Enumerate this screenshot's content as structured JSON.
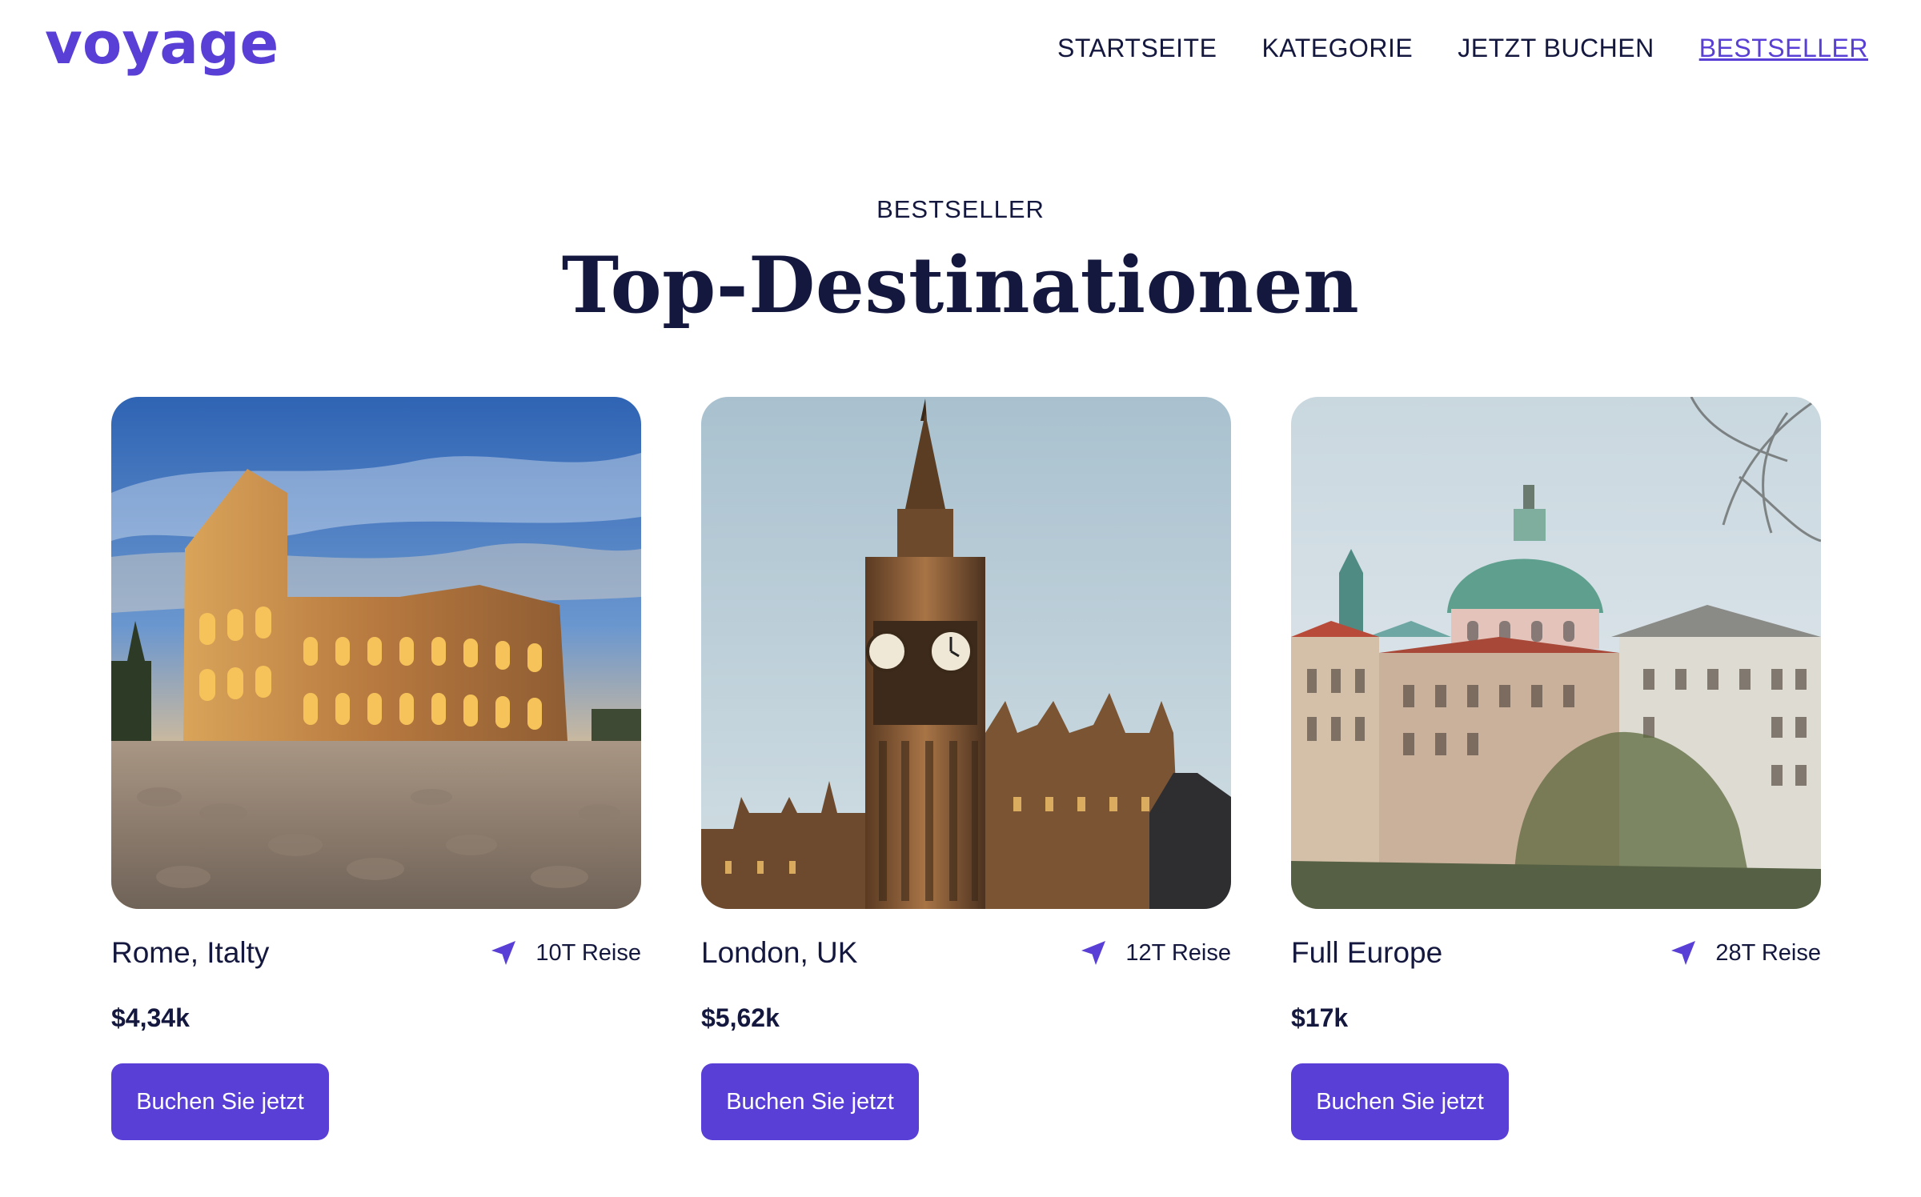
{
  "header": {
    "logo": "voyage",
    "nav": [
      {
        "label": "STARTSEITE"
      },
      {
        "label": "KATEGORIE"
      },
      {
        "label": "JETZT BUCHEN"
      },
      {
        "label": "BESTSELLER"
      }
    ]
  },
  "section": {
    "eyebrow": "BESTSELLER",
    "title": "Top-Destinationen"
  },
  "cards": [
    {
      "place": "Rome, Italty",
      "trip": "10T Reise",
      "price": "$4,34k",
      "button": "Buchen Sie jetzt"
    },
    {
      "place": "London, UK",
      "trip": "12T Reise",
      "price": "$5,62k",
      "button": "Buchen Sie jetzt"
    },
    {
      "place": "Full Europe",
      "trip": "28T Reise",
      "price": "$17k",
      "button": "Buchen Sie jetzt"
    }
  ],
  "colors": {
    "accent": "#5a3fd6",
    "text": "#14183e"
  },
  "icons": {
    "trip": "navigation-arrow-icon"
  }
}
